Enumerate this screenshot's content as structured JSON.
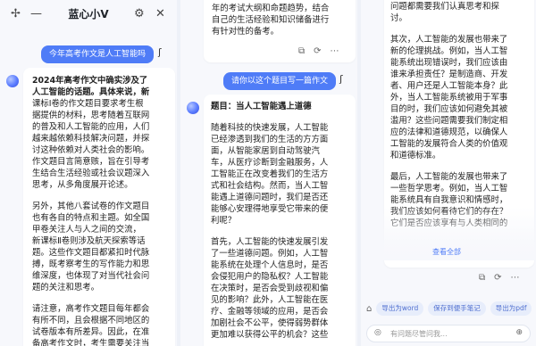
{
  "app": {
    "title": "蓝心小V",
    "back_icon": "back-arrow-icon",
    "accent_color": "#4f7cf7"
  },
  "panel1": {
    "question": "今年高考作文是人工智能吗",
    "answer_lines": [
      "2024年高考作文中确实涉及了",
      "人工智能的话题。具体来说，新",
      "课标Ⅰ卷的作文题目要求考生根",
      "据提供的材料，思考随着互联网",
      "的普及和人工智能的应用，人们",
      "越来越依赖科技解决问题，并探",
      "讨这种依赖对人类社会的影响。",
      "作文题目言简意赅，旨在引导考",
      "生结合生活经验或社会议题深入",
      "思考，从多角度展开论述。",
      "",
      "另外，其他八套试卷的作文题目",
      "也有各自的特点和主题。如全国",
      "甲卷关注人与人之间的交流，",
      "新课标Ⅱ卷则涉及航天探索等话",
      "题。这些作文题目都紧扣时代脉",
      "搏，既考察考生的写作能力和思",
      "维深度，也体现了对当代社会问",
      "题的关注和思考。",
      "",
      "请注意，高考作文题目每年都会",
      "有所不同，且会根据不同地区的",
      "试卷版本有所差异。因此，在准",
      "备高考作文时，考生需要关注当"
    ],
    "bold_lines": 2
  },
  "panel2": {
    "top_lines": [
      "年的考试大纲和命题趋势，结合",
      "自己的生活经验和知识储备进行",
      "有针对性的备考。"
    ],
    "question": "请你以这个题目写一篇作文",
    "answer_lines": [
      "题目：当人工智能遇上道德",
      "",
      "随着科技的快速发展，人工智能",
      "已经渗透到我们的生活的方方面",
      "面，从智能家居到自动驾驶汽",
      "车，从医疗诊断到金融服务，人",
      "工智能正在改变着我们的生活方",
      "式和社会结构。然而，当人工智",
      "能遇上道德问题时，我们是否还",
      "能够心安理得地享受它带来的便",
      "利呢？",
      "",
      "首先，人工智能的快速发展引发",
      "了一些道德问题。例如，人工智",
      "能系统在处理个人信息时，是否",
      "会侵犯用户的隐私权？人工智能",
      "在决策时，是否会受到歧视和偏",
      "见的影响？此外，人工智能在医",
      "疗、金融等领域的应用，是否会",
      "加剧社会不公平，使得弱势群体",
      "更加难以获得公平的机会？这些"
    ],
    "bold_lines": 1
  },
  "panel3": {
    "answer_lines": [
      "问题都需要我们认真思考和探",
      "讨。",
      "",
      "其次，人工智能的发展也带来了",
      "新的伦理挑战。例如，当人工智",
      "能系统出现错误时，我们应该由",
      "谁来承担责任？是制造商、开发",
      "者、用户还是人工智能本身？此",
      "外，当人工智能系统被用于军事",
      "目的时，我们应该如何避免其被",
      "滥用？这些问题需要我们制定相",
      "应的法律和道德规范，以确保人",
      "工智能的发展符合人类的价值观",
      "和道德标准。",
      "",
      "最后，人工智能的发展也带来了",
      "一些哲学思考。例如，当人工智",
      "能系统具有自我意识和情感时，",
      "我们应该如何看待它们的存在？",
      "它们是否应该享有与人类相同的"
    ],
    "more_label": "查看全部",
    "chips": [
      "导出为word",
      "保存到便手笔记",
      "导出为pdf"
    ],
    "input_placeholder": "有问题尽管问我..."
  }
}
